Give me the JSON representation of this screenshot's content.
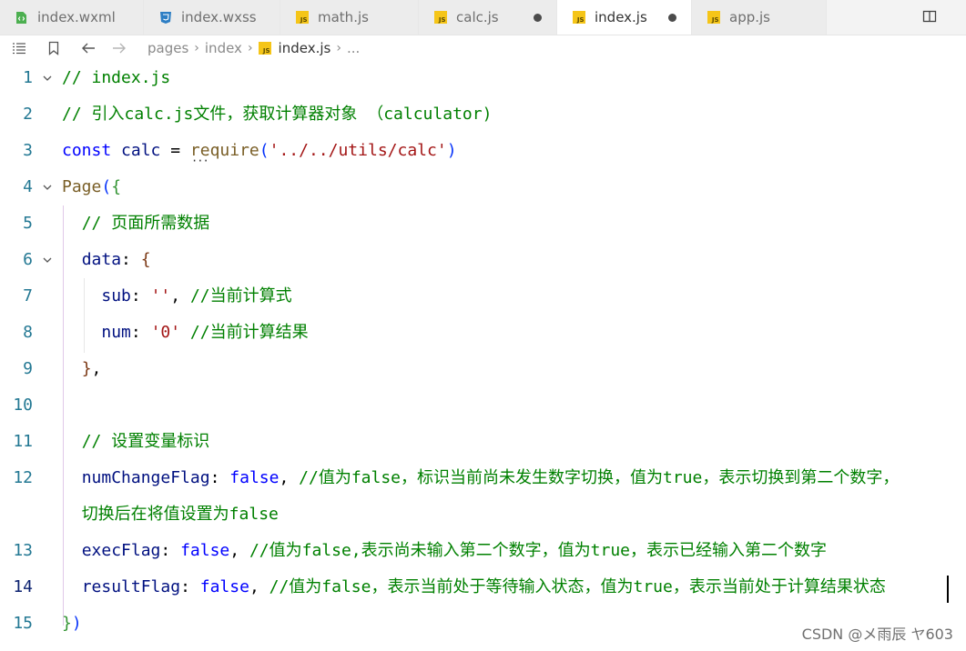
{
  "tabs": [
    {
      "label": "index.wxml",
      "icon": "wxml-file-icon",
      "active": false,
      "modified": false
    },
    {
      "label": "index.wxss",
      "icon": "css-file-icon",
      "active": false,
      "modified": false
    },
    {
      "label": "math.js",
      "icon": "js-file-icon",
      "active": false,
      "modified": false
    },
    {
      "label": "calc.js",
      "icon": "js-file-icon",
      "active": false,
      "modified": true
    },
    {
      "label": "index.js",
      "icon": "js-file-icon",
      "active": true,
      "modified": true
    },
    {
      "label": "app.js",
      "icon": "js-file-icon",
      "active": false,
      "modified": false
    }
  ],
  "js_badge_text": "JS",
  "breadcrumb": {
    "segments": [
      "pages",
      "index",
      "index.js"
    ],
    "trailing": "..."
  },
  "editor": {
    "lines": [
      {
        "n": "1",
        "segments": [
          [
            "cm",
            "// index.js"
          ]
        ]
      },
      {
        "n": "2",
        "segments": [
          [
            "cm",
            "// 引入calc.js文件，获取计算器对象 （calculator)"
          ]
        ]
      },
      {
        "n": "3",
        "segments": [
          [
            "kw",
            "const "
          ],
          [
            "id",
            "calc"
          ],
          [
            "pn",
            " = "
          ],
          [
            "fn",
            "require"
          ],
          [
            "br1",
            "("
          ],
          [
            "str",
            "'../../utils/calc'"
          ],
          [
            "br1",
            ")"
          ]
        ]
      },
      {
        "n": "4",
        "segments": [
          [
            "fn",
            "Page"
          ],
          [
            "br1",
            "("
          ],
          [
            "br2",
            "{"
          ]
        ]
      },
      {
        "n": "5",
        "segments": [
          [
            "pn",
            "  "
          ],
          [
            "cm",
            "// 页面所需数据"
          ]
        ]
      },
      {
        "n": "6",
        "segments": [
          [
            "pn",
            "  "
          ],
          [
            "id",
            "data"
          ],
          [
            "pn",
            ": "
          ],
          [
            "br3",
            "{"
          ]
        ]
      },
      {
        "n": "7",
        "segments": [
          [
            "pn",
            "    "
          ],
          [
            "id",
            "sub"
          ],
          [
            "pn",
            ": "
          ],
          [
            "str",
            "''"
          ],
          [
            "pn",
            ", "
          ],
          [
            "cm",
            "//当前计算式"
          ]
        ]
      },
      {
        "n": "8",
        "segments": [
          [
            "pn",
            "    "
          ],
          [
            "id",
            "num"
          ],
          [
            "pn",
            ": "
          ],
          [
            "str",
            "'0'"
          ],
          [
            "pn",
            " "
          ],
          [
            "cm",
            "//当前计算结果"
          ]
        ]
      },
      {
        "n": "9",
        "segments": [
          [
            "pn",
            "  "
          ],
          [
            "br3",
            "}"
          ],
          [
            "pn",
            ","
          ]
        ]
      },
      {
        "n": "10",
        "segments": []
      },
      {
        "n": "11",
        "segments": [
          [
            "pn",
            "  "
          ],
          [
            "cm",
            "// 设置变量标识"
          ]
        ]
      },
      {
        "n": "12",
        "segments": [
          [
            "pn",
            "  "
          ],
          [
            "id",
            "numChangeFlag"
          ],
          [
            "pn",
            ": "
          ],
          [
            "bool",
            "false"
          ],
          [
            "pn",
            ", "
          ],
          [
            "cm",
            "//值为false，标识当前尚未发生数字切换，值为true，表示切换到第二个数字，"
          ]
        ]
      },
      {
        "n": "",
        "segments": [
          [
            "pn",
            "  "
          ],
          [
            "cm",
            "切换后在将值设置为false"
          ]
        ]
      },
      {
        "n": "13",
        "segments": [
          [
            "pn",
            "  "
          ],
          [
            "id",
            "execFlag"
          ],
          [
            "pn",
            ": "
          ],
          [
            "bool",
            "false"
          ],
          [
            "pn",
            ", "
          ],
          [
            "cm",
            "//值为false,表示尚未输入第二个数字，值为true，表示已经输入第二个数字"
          ]
        ]
      },
      {
        "n": "14",
        "segments": [
          [
            "pn",
            "  "
          ],
          [
            "id",
            "resultFlag"
          ],
          [
            "pn",
            ": "
          ],
          [
            "bool",
            "false"
          ],
          [
            "pn",
            ", "
          ],
          [
            "cm",
            "//值为false，表示当前处于等待输入状态，值为true，表示当前处于计算结果状态"
          ]
        ]
      },
      {
        "n": "15",
        "segments": [
          [
            "br2",
            "}"
          ],
          [
            "br1",
            ")"
          ]
        ]
      }
    ],
    "current_line": "14"
  },
  "watermark": "CSDN @メ雨辰   ヤ603",
  "colors": {
    "comment": "#008000",
    "keyword": "#0000ff",
    "string": "#a31515",
    "function": "#795e26",
    "line_number": "#237893"
  }
}
